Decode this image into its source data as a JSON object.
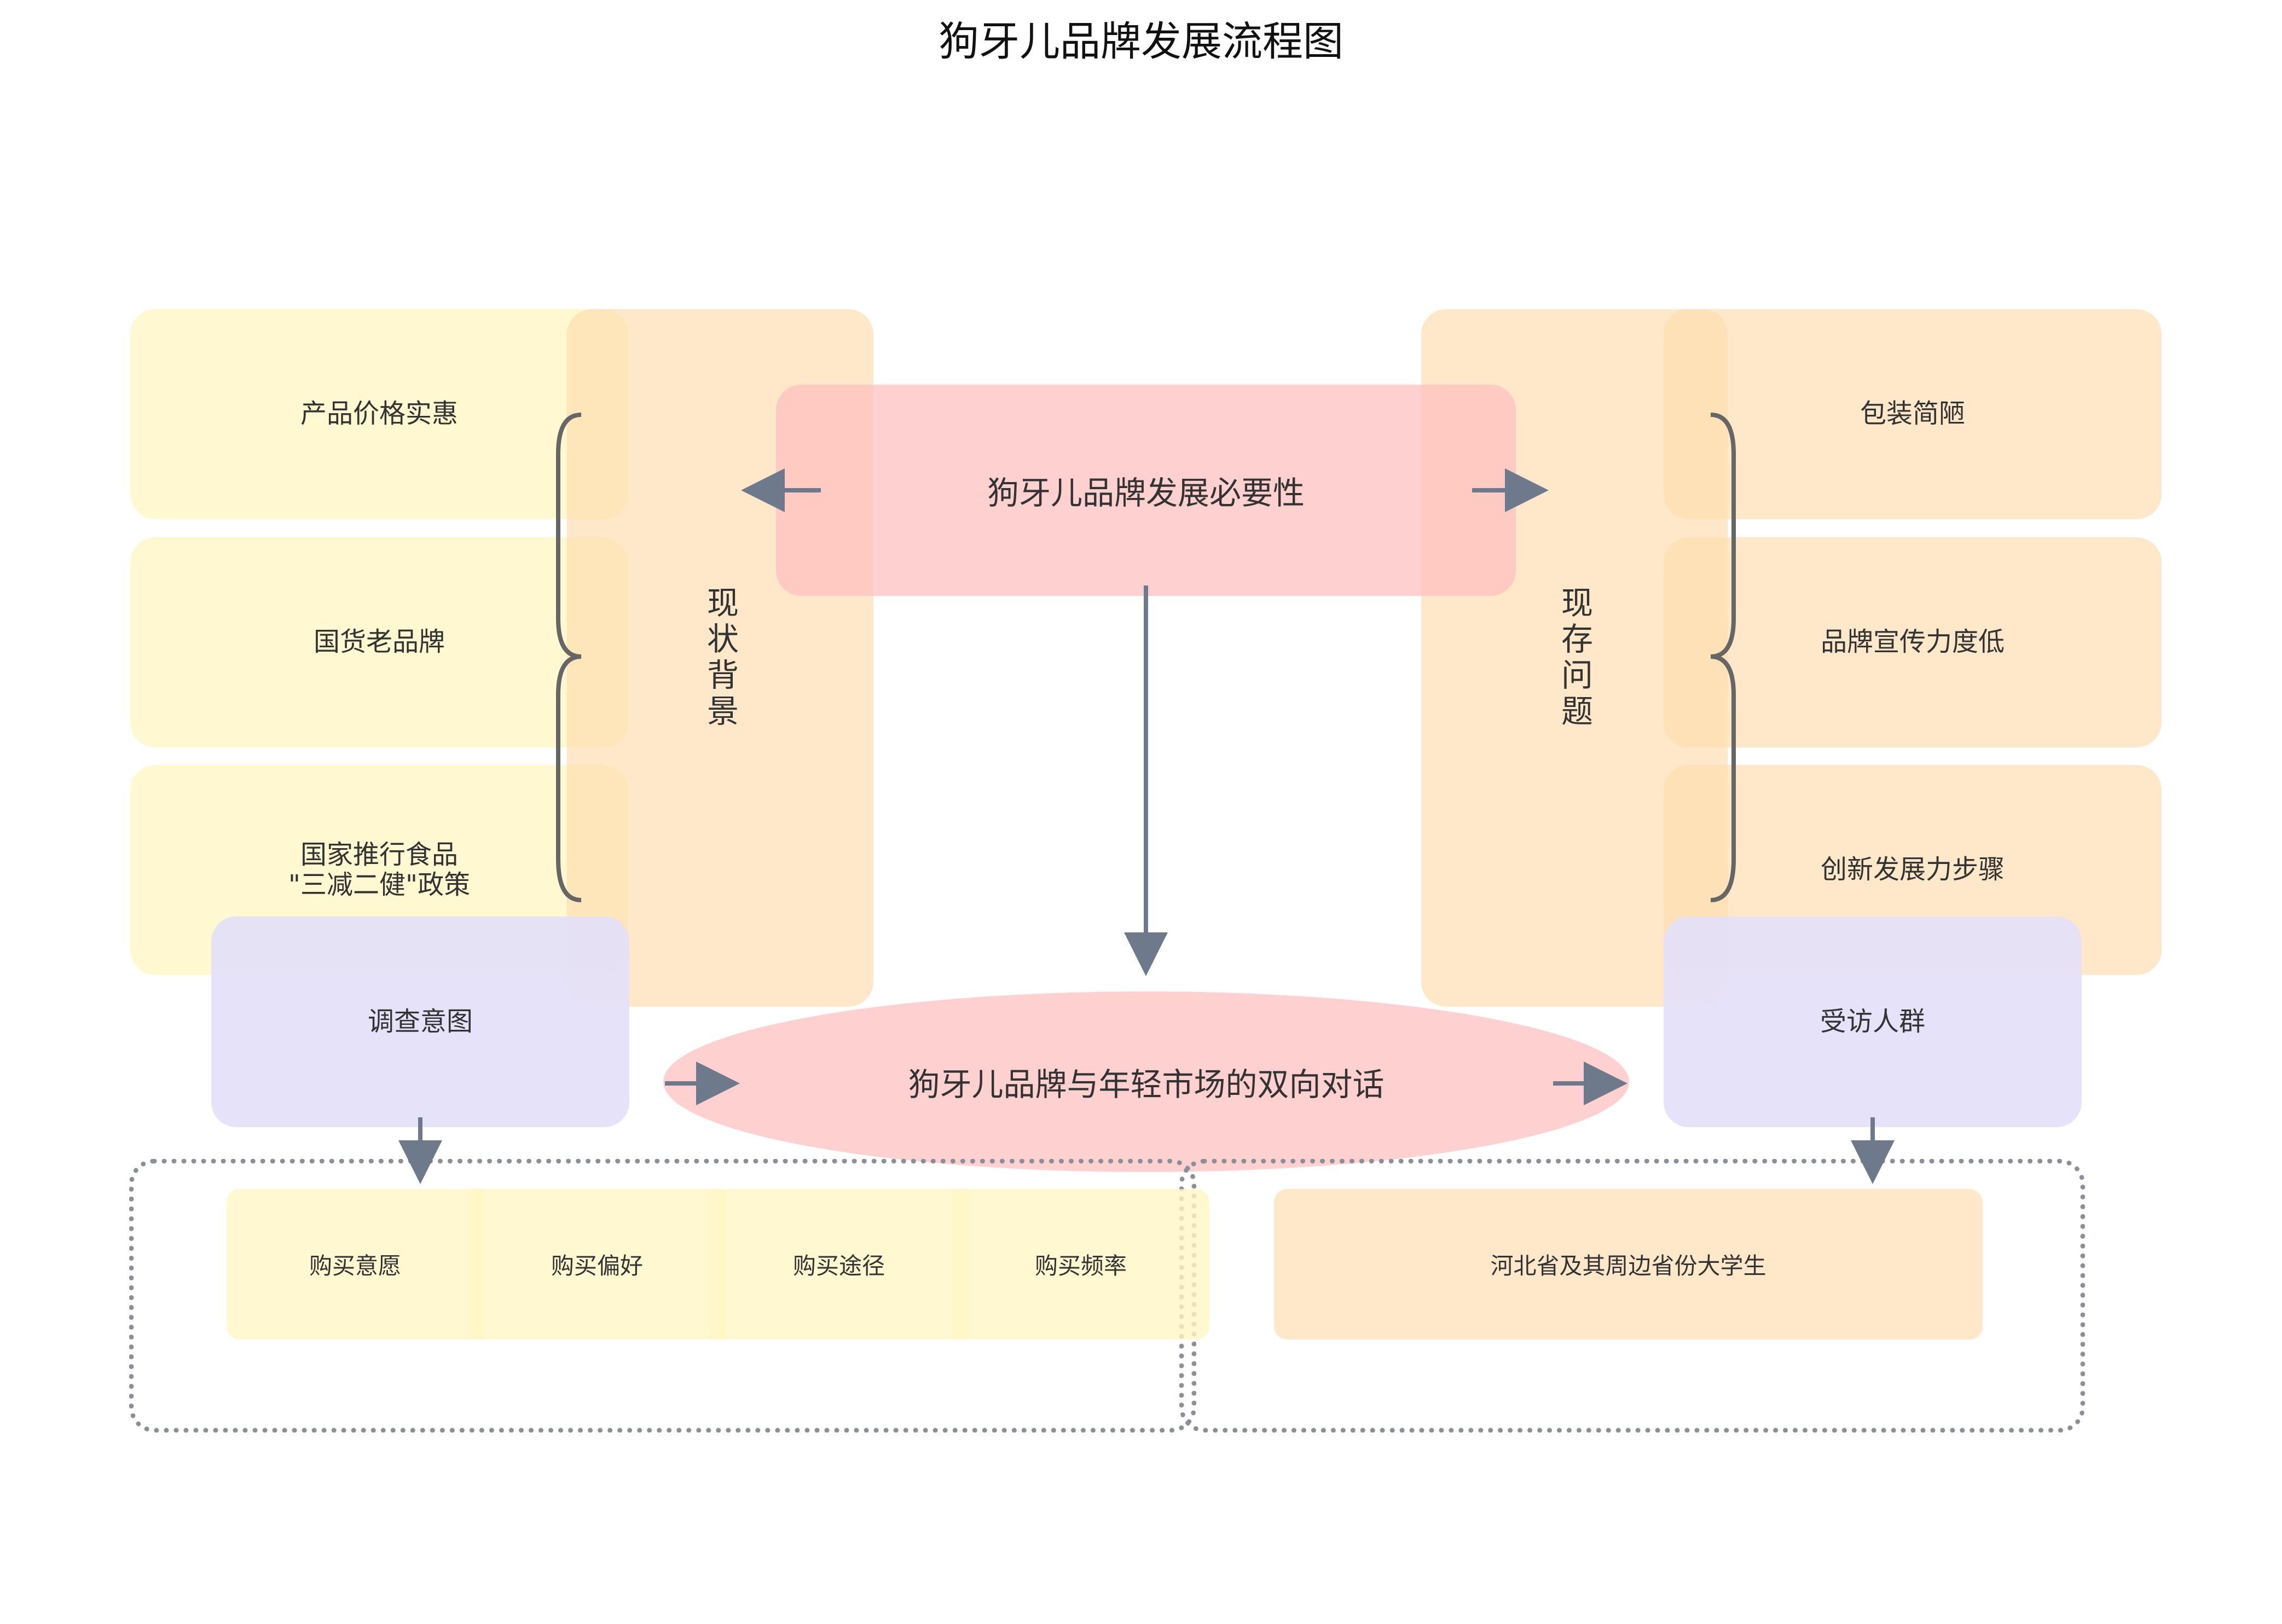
{
  "title": "狗牙儿品牌发展流程图",
  "center_top": "狗牙儿品牌发展必要性",
  "left_group_label": "现状背景",
  "right_group_label": "现存问题",
  "left_items": [
    "产品价格实惠",
    "国货老品牌",
    "国家推行食品\n\"三减二健\"政策"
  ],
  "right_items": [
    "包装简陋",
    "品牌宣传力度低",
    "创新发展力步骤"
  ],
  "left_bottom": "调查意图",
  "right_bottom": "受访人群",
  "center_ellipse": "狗牙儿品牌与年轻市场的双向对话",
  "intent_cells": [
    "购买意愿",
    "购买偏好",
    "购买途径",
    "购买频率"
  ],
  "respondents": "河北省及其周边省份大学生",
  "colors": {
    "yellow": "#FFF6C4",
    "peach": "#FFDDB0",
    "pink": "#FFBEBE",
    "lavender": "#E4E0F8",
    "arrow": "#6E7A8C",
    "brace": "#666666",
    "dotted_border": "#8A8F98"
  }
}
